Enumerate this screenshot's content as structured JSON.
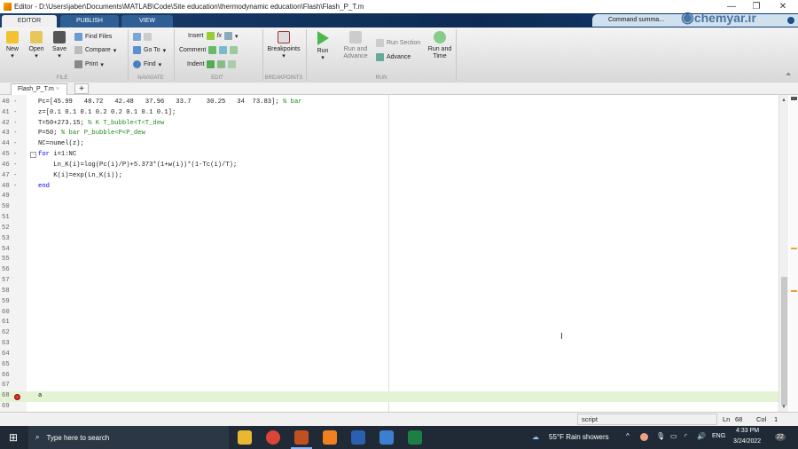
{
  "window": {
    "title": "Editor - D:\\Users\\jaber\\Documents\\MATLAB\\Code\\Site education\\thermodynamic education\\Flash\\Flash_P_T.m",
    "minimize": "—",
    "restore": "❐",
    "close": "✕"
  },
  "ribbon_tabs": [
    "EDITOR",
    "PUBLISH",
    "VIEW"
  ],
  "quick_access": {
    "command_summary": "Command summa..."
  },
  "watermark": "chemyar.ir",
  "ribbon": {
    "file": {
      "new": "New",
      "open": "Open",
      "save": "Save",
      "find_files": "Find Files",
      "compare": "Compare",
      "print": "Print",
      "section": "FILE"
    },
    "navigate": {
      "goto": "Go To",
      "find": "Find",
      "section": "NAVIGATE"
    },
    "edit": {
      "insert": "Insert",
      "comment": "Comment",
      "indent": "Indent",
      "fx": "fx",
      "section": "EDIT"
    },
    "breakpoints": {
      "label": "Breakpoints",
      "section": "BREAKPOINTS"
    },
    "run": {
      "run": "Run",
      "run_advance": "Run and Advance",
      "run_section": "Run Section",
      "advance": "Advance",
      "run_time": "Run and Time",
      "section": "RUN"
    }
  },
  "file_tab": {
    "name": "Flash_P_T.m",
    "close": "×",
    "add": "+"
  },
  "editor": {
    "lines": [
      {
        "n": "40 -",
        "code": "Pc=[45.99   48.72   42.48   37.96   33.7    30.25   34  73.83]; ",
        "comment": "% bar"
      },
      {
        "n": "41 -",
        "code": "z=[0.1 0.1 0.1 0.2 0.2 0.1 0.1 0.1];",
        "comment": ""
      },
      {
        "n": "42 -",
        "code": "T=50+273.15; ",
        "comment": "% K T_bubble<T<T_dew"
      },
      {
        "n": "43 -",
        "code": "P=50; ",
        "comment": "% bar P_bubble<P<P_dew"
      },
      {
        "n": "44 -",
        "code": "NC=numel(z);",
        "comment": ""
      },
      {
        "n": "45 -",
        "kw": "for",
        "code": " i=1:NC",
        "comment": ""
      },
      {
        "n": "46 -",
        "code": "    Ln_K(i)=log(Pc(i)/P)+5.373*(1+w(i))*(1-Tc(i)/T);",
        "comment": ""
      },
      {
        "n": "47 -",
        "code": "    K(i)=exp(Ln_K(i));",
        "comment": ""
      },
      {
        "n": "48 -",
        "kw": "end",
        "code": "",
        "comment": ""
      },
      {
        "n": "49",
        "code": "",
        "comment": ""
      },
      {
        "n": "50",
        "code": "",
        "comment": ""
      },
      {
        "n": "51",
        "code": "",
        "comment": ""
      },
      {
        "n": "52",
        "code": "",
        "comment": ""
      },
      {
        "n": "53",
        "code": "",
        "comment": ""
      },
      {
        "n": "54",
        "code": "",
        "comment": ""
      },
      {
        "n": "55",
        "code": "",
        "comment": ""
      },
      {
        "n": "56",
        "code": "",
        "comment": ""
      },
      {
        "n": "57",
        "code": "",
        "comment": ""
      },
      {
        "n": "58",
        "code": "",
        "comment": ""
      },
      {
        "n": "59",
        "code": "",
        "comment": ""
      },
      {
        "n": "60",
        "code": "",
        "comment": ""
      },
      {
        "n": "61",
        "code": "",
        "comment": ""
      },
      {
        "n": "62",
        "code": "",
        "comment": ""
      },
      {
        "n": "63",
        "code": "",
        "comment": ""
      },
      {
        "n": "64",
        "code": "",
        "comment": ""
      },
      {
        "n": "65",
        "code": "",
        "comment": ""
      },
      {
        "n": "66",
        "code": "",
        "comment": ""
      },
      {
        "n": "67",
        "code": "",
        "comment": ""
      },
      {
        "n": "68",
        "code": "a",
        "comment": "",
        "current": true,
        "breakpoint": true
      },
      {
        "n": "69",
        "code": "",
        "comment": ""
      }
    ]
  },
  "status": {
    "type": "script",
    "ln_label": "Ln",
    "ln": "68",
    "col_label": "Col",
    "col": "1"
  },
  "taskbar": {
    "search_placeholder": "Type here to search",
    "weather": "55°F  Rain showers",
    "lang": "ENG",
    "time": "4:33 PM",
    "date": "3/24/2022",
    "notifications": "22"
  }
}
